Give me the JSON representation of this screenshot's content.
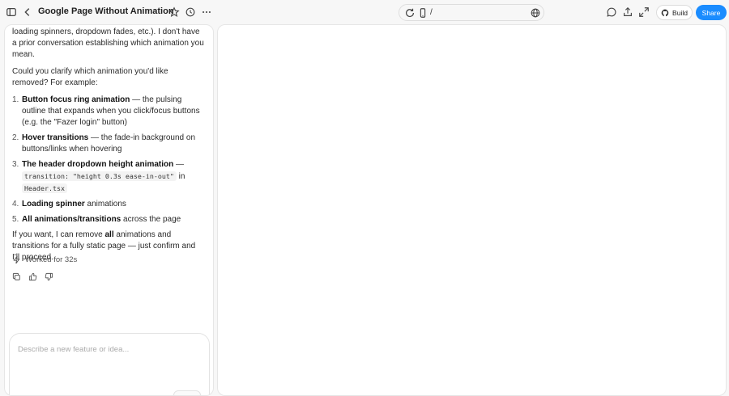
{
  "header": {
    "title": "Google Page Without Animation",
    "url_path": "/",
    "build_label": "Build",
    "share_label": "Share"
  },
  "chat": {
    "intro": "animations (button focus rings, hover transitions, loading spinners, dropdown fades, etc.). I don't have a prior conversation establishing which animation you mean.",
    "question": "Could you clarify which animation you'd like removed? For example:",
    "options": [
      {
        "num": "1.",
        "bold": "Button focus ring animation",
        "rest": " — the pulsing outline that expands when you click/focus buttons (e.g. the \"Fazer login\" button)"
      },
      {
        "num": "2.",
        "bold": "Hover transitions",
        "rest": " — the fade-in background on buttons/links when hovering"
      },
      {
        "num": "3.",
        "bold": "The header dropdown height animation",
        "rest_pre": " — ",
        "code1": "transition: \"height 0.3s ease-in-out\"",
        "rest_mid": " in ",
        "code2": "Header.tsx"
      },
      {
        "num": "4.",
        "bold": "Loading spinner",
        "rest": " animations"
      },
      {
        "num": "5.",
        "bold": "All animations/transitions",
        "rest": " across the page"
      }
    ],
    "closing_pre": "If you want, I can remove ",
    "closing_bold": "all",
    "closing_post": " animations and transitions for a fully static page — just confirm and I'll proceed.",
    "worked_label": "Worked for 32s",
    "composer_placeholder": "Describe a new feature or idea..."
  },
  "icons": {
    "sidebar_toggle": "sidebar-icon",
    "back": "chevron-left-icon",
    "star": "star-icon",
    "history": "history-icon",
    "more": "more-icon",
    "refresh": "refresh-icon",
    "device": "mobile-icon",
    "globe": "globe-icon",
    "chat": "chat-icon",
    "upload": "upload-icon",
    "expand": "expand-icon",
    "github": "github-icon",
    "bolt": "bolt-icon",
    "copy": "copy-icon",
    "thumbs_up": "thumbs-up-icon",
    "thumbs_down": "thumbs-down-icon"
  }
}
